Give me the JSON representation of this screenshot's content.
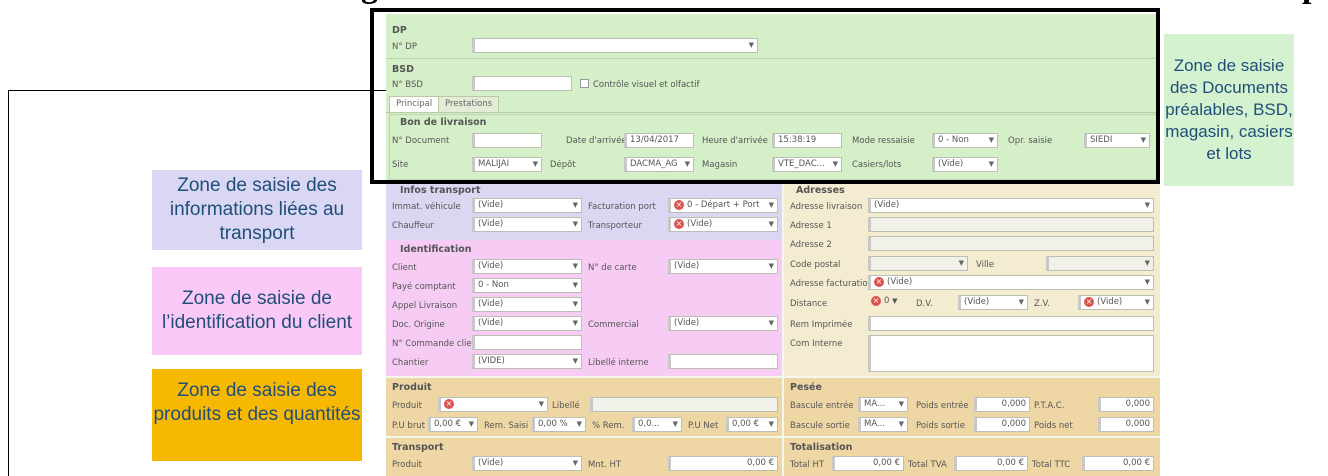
{
  "heading": {
    "left": "g",
    "right": "p"
  },
  "callouts": {
    "dp": "Zone de saisie des Documents préalables, BSD, magasin, casiers et lots",
    "transport": "Zone de saisie des informations liées au transport",
    "ident": "Zone de saisie de l’identification du client",
    "produit": "Zone de saisie des produits et des quantités"
  },
  "colors": {
    "green": "#d5efc9",
    "purple": "#dcd6f2",
    "pink": "#f6ccf4",
    "orange": "#f6b800",
    "beige": "#f3ecd0",
    "gold": "#efd7a5"
  },
  "dp": {
    "title": "DP",
    "label": "N° DP",
    "value": ""
  },
  "bsd": {
    "title": "BSD",
    "label": "N° BSD",
    "value": "",
    "check_label": "Contrôle visuel et olfactif"
  },
  "tabs": [
    "Principal",
    "Prestations"
  ],
  "bon": {
    "title": "Bon de livraison",
    "doc_label": "N° Document",
    "doc_value": "",
    "date_label": "Date d'arrivée",
    "date_value": "13/04/2017",
    "heure_label": "Heure d'arrivée",
    "heure_value": "15:38:19",
    "mode_label": "Mode ressaisie",
    "mode_value": "0 - Non",
    "opr_label": "Opr. saisie",
    "opr_value": "SIEDI",
    "site_label": "Site",
    "site_value": "MALIJAI",
    "depot_label": "Dépôt",
    "depot_value": "DACMA_AG",
    "magasin_label": "Magasin",
    "magasin_value": "VTE_DAC...",
    "casiers_label": "Casiers/lots",
    "casiers_value": "(Vide)"
  },
  "transport": {
    "title": "Infos transport",
    "immat_label": "Immat. véhicule",
    "immat_value": "(Vide)",
    "fact_label": "Facturation port",
    "fact_value": "0 - Départ + Port",
    "chauffeur_label": "Chauffeur",
    "chauffeur_value": "(Vide)",
    "transporteur_label": "Transporteur",
    "transporteur_value": "(Vide)"
  },
  "ident": {
    "title": "Identification",
    "client_label": "Client",
    "client_value": "(Vide)",
    "carte_label": "N° de carte",
    "carte_value": "(Vide)",
    "paye_label": "Payé comptant",
    "paye_value": "0 - Non",
    "appel_label": "Appel Livraison",
    "appel_value": "(Vide)",
    "docorig_label": "Doc. Origine",
    "docorig_value": "(Vide)",
    "commercial_label": "Commercial",
    "commercial_value": "(Vide)",
    "cmd_label": "N° Commande clie",
    "cmd_value": "",
    "chantier_label": "Chantier",
    "chantier_value": "(VIDE)",
    "libelle_label": "Libellé interne",
    "libelle_value": ""
  },
  "adresses": {
    "title": "Adresses",
    "liv_label": "Adresse livraison",
    "liv_value": "(Vide)",
    "a1_label": "Adresse 1",
    "a2_label": "Adresse 2",
    "cp_label": "Code postal",
    "ville_label": "Ville",
    "fact_label": "Adresse facturatio",
    "fact_value": "(Vide)",
    "dist_label": "Distance",
    "dist_value": "0",
    "dv_label": "D.V.",
    "dv_value": "(Vide)",
    "zv_label": "Z.V.",
    "zv_value": "(Vide)",
    "rem_label": "Rem Imprimée",
    "com_label": "Com Interne"
  },
  "produit": {
    "title": "Produit",
    "prod_label": "Produit",
    "libelle_label": "Libellé",
    "pubrut_label": "P.U brut",
    "pubrut_value": "0,00 €",
    "remsaisi_label": "Rem. Saisi",
    "remsaisi_value": "0,00 %",
    "pctrem_label": "% Rem.",
    "pctrem_value": "0,0...",
    "punet_label": "P.U Net",
    "punet_value": "0,00 €"
  },
  "pesee": {
    "title": "Pesée",
    "be_label": "Bascule entrée",
    "be_value": "MA...",
    "pe_label": "Poids entrée",
    "pe_value": "0,000",
    "ptac_label": "P.T.A.C.",
    "ptac_value": "0,000",
    "bs_label": "Bascule sortie",
    "bs_value": "MA...",
    "ps_label": "Poids sortie",
    "ps_value": "0,000",
    "pn_label": "Poids net",
    "pn_value": "0,000"
  },
  "transport2": {
    "title": "Transport",
    "prod_label": "Produit",
    "prod_value": "(Vide)",
    "mnt_label": "Mnt. HT",
    "mnt_value": "0,00 €"
  },
  "totalisation": {
    "title": "Totalisation",
    "ht_label": "Total HT",
    "ht_value": "0,00 €",
    "tva_label": "Total TVA",
    "tva_value": "0,00 €",
    "ttc_label": "Total TTC",
    "ttc_value": "0,00 €"
  }
}
